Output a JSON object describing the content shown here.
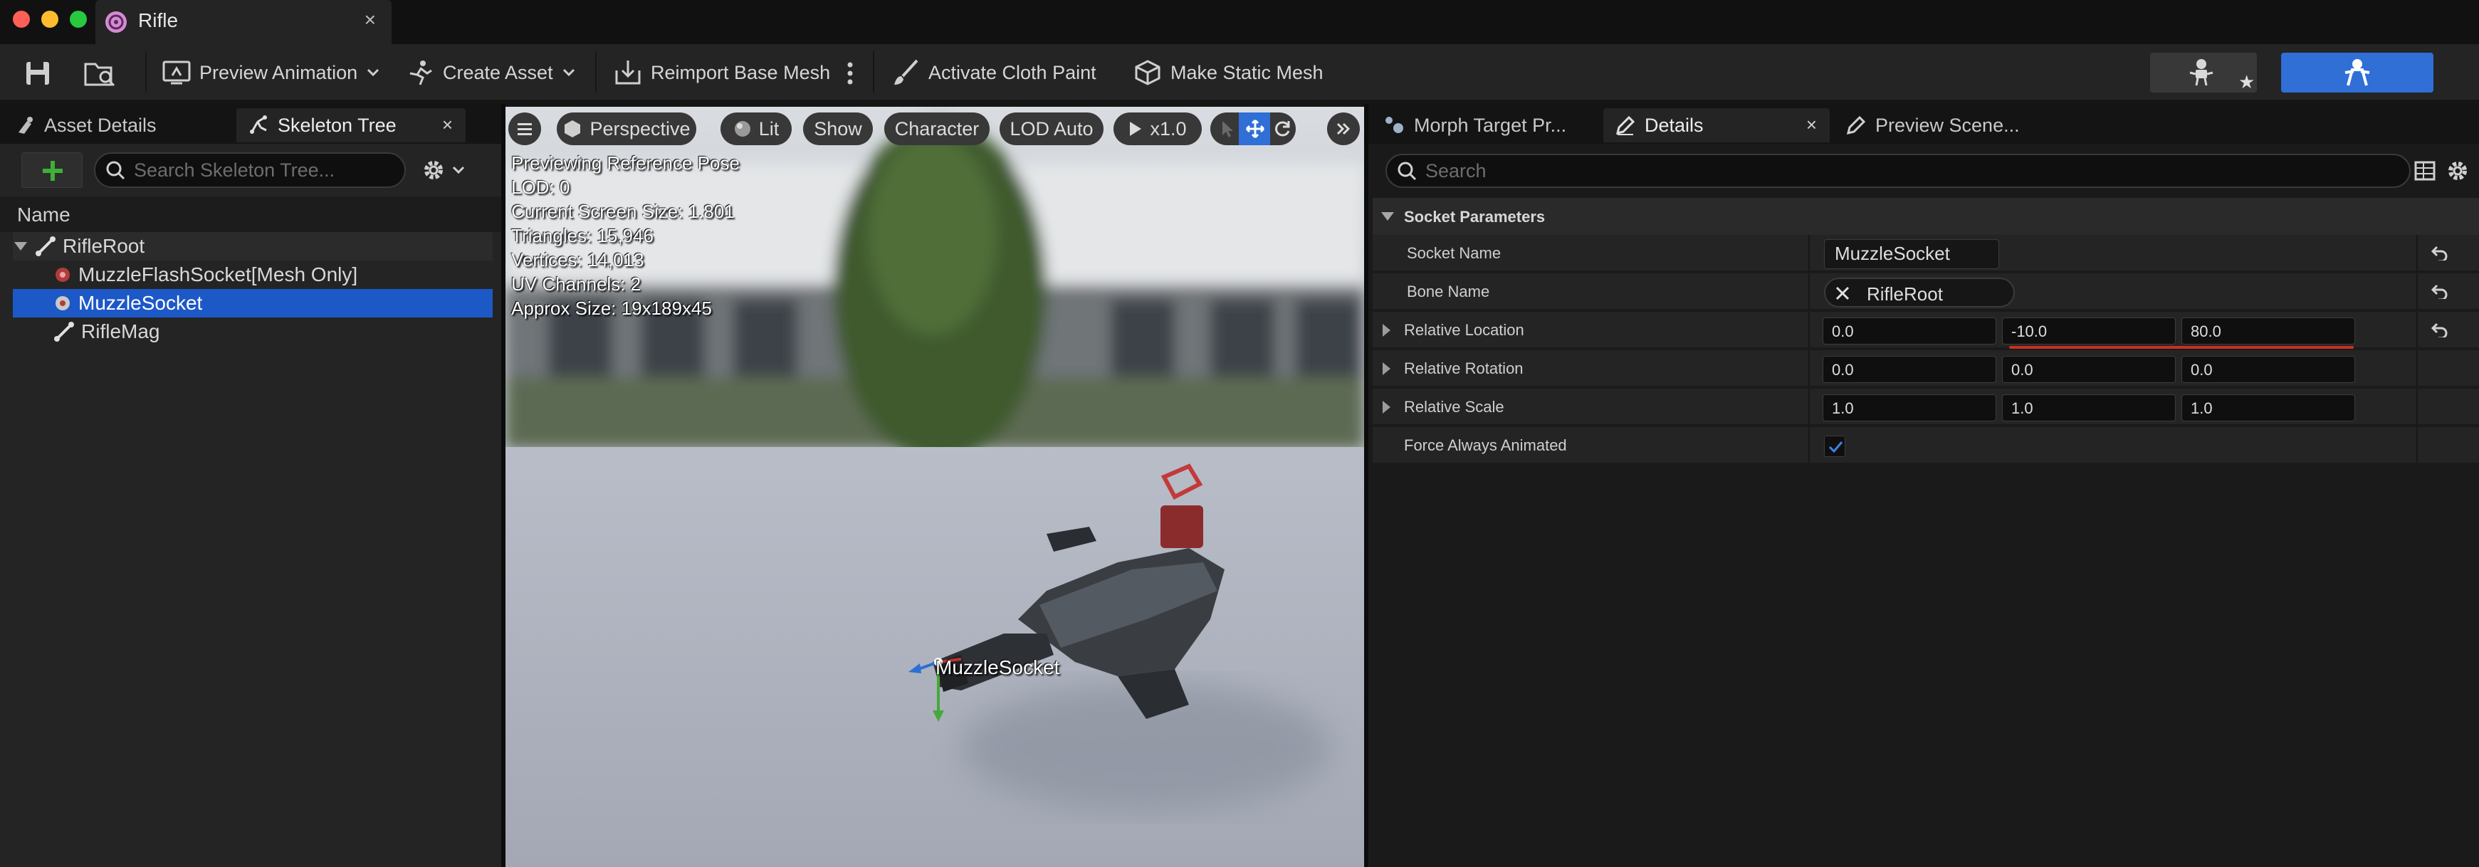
{
  "window": {
    "tab_title": "Rifle",
    "tab_close": "×"
  },
  "toolbar": {
    "preview_animation": "Preview Animation",
    "create_asset": "Create Asset",
    "reimport_base_mesh": "Reimport Base Mesh",
    "activate_cloth_paint": "Activate Cloth Paint",
    "make_static_mesh": "Make Static Mesh"
  },
  "left_panel": {
    "tabs": [
      {
        "label": "Asset Details"
      },
      {
        "label": "Skeleton Tree"
      }
    ],
    "close": "×",
    "search_placeholder": "Search Skeleton Tree...",
    "column_header": "Name",
    "tree": [
      {
        "label": "RifleRoot",
        "suffix": "",
        "icon": "bone-icon",
        "selected": false
      },
      {
        "label": "MuzzleFlashSocket",
        "suffix": "[Mesh Only]",
        "icon": "socket-icon",
        "selected": false
      },
      {
        "label": "MuzzleSocket",
        "suffix": "",
        "icon": "socket-icon",
        "selected": true
      },
      {
        "label": "RifleMag",
        "suffix": "",
        "icon": "bone-icon",
        "selected": false
      }
    ]
  },
  "viewport": {
    "perspective": "Perspective",
    "lit": "Lit",
    "show": "Show",
    "character": "Character",
    "lod": "LOD Auto",
    "speed": "x1.0",
    "stats": [
      "Previewing Reference Pose",
      "LOD: 0",
      "Current Screen Size: 1.801",
      "Triangles: 15,946",
      "Vertices: 14,013",
      "UV Channels: 2",
      "Approx Size: 19x189x45"
    ],
    "socket_label": "MuzzleSocket"
  },
  "right_panel": {
    "tabs": [
      {
        "label": "Morph Target Pr..."
      },
      {
        "label": "Details"
      },
      {
        "label": "Preview Scene..."
      }
    ],
    "close": "×",
    "search_placeholder": "Search",
    "section_title": "Socket Parameters",
    "properties": {
      "socket_name": {
        "label": "Socket Name",
        "value": "MuzzleSocket"
      },
      "bone_name": {
        "label": "Bone Name",
        "value": "RifleRoot"
      },
      "relative_location": {
        "label": "Relative Location",
        "values": [
          "0.0",
          "-10.0",
          "80.0"
        ]
      },
      "relative_rotation": {
        "label": "Relative Rotation",
        "values": [
          "0.0",
          "0.0",
          "0.0"
        ]
      },
      "relative_scale": {
        "label": "Relative Scale",
        "values": [
          "1.0",
          "1.0",
          "1.0"
        ]
      },
      "force_always_animated": {
        "label": "Force Always Animated",
        "checked": true
      }
    }
  },
  "colors": {
    "accent_blue": "#2f6fd6",
    "selection_blue": "#1d58c7",
    "add_green": "#3fb037",
    "modified_red": "#c8301e"
  }
}
